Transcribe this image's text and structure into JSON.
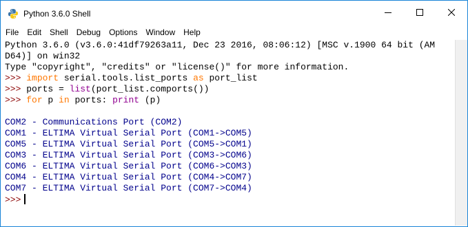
{
  "window": {
    "title": "Python 3.6.0 Shell",
    "accent": "#1883d7",
    "icon": "python-icon"
  },
  "menu": [
    "File",
    "Edit",
    "Shell",
    "Debug",
    "Options",
    "Window",
    "Help"
  ],
  "shell": {
    "banner_line1": "Python 3.6.0 (v3.6.0:41df79263a11, Dec 23 2016, 08:06:12) [MSC v.1900 64 bit (AM",
    "banner_line2": "D64)] on win32",
    "banner_line3": "Type \"copyright\", \"credits\" or \"license()\" for more information.",
    "prompt": ">>>",
    "cmd1": {
      "kw_import": "import",
      "module": " serial.tools.list_ports ",
      "kw_as": "as",
      "alias": " port_list"
    },
    "cmd2": {
      "pre": " ports = ",
      "builtin": "list",
      "post": "(port_list.comports())"
    },
    "cmd3": {
      "kw_for": "for",
      "var": " p ",
      "kw_in": "in",
      "mid": " ports: ",
      "builtin": "print",
      "post": " (p)"
    },
    "output": [
      "COM2 - Communications Port (COM2)",
      "COM1 - ELTIMA Virtual Serial Port (COM1->COM5)",
      "COM5 - ELTIMA Virtual Serial Port (COM5->COM1)",
      "COM3 - ELTIMA Virtual Serial Port (COM3->COM6)",
      "COM6 - ELTIMA Virtual Serial Port (COM6->COM3)",
      "COM4 - ELTIMA Virtual Serial Port (COM4->COM7)",
      "COM7 - ELTIMA Virtual Serial Port (COM7->COM4)"
    ]
  },
  "colors": {
    "prompt": "#8b0000",
    "keyword": "#ff7700",
    "builtin": "#900090",
    "output": "#00008b"
  }
}
